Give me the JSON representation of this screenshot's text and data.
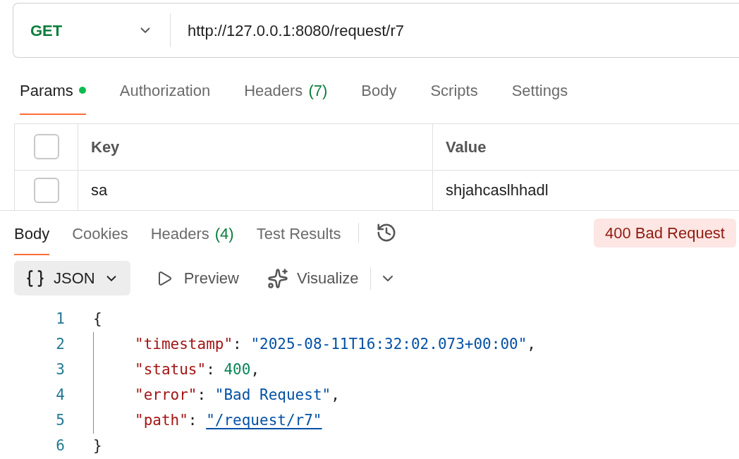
{
  "request_bar": {
    "method": "GET",
    "url": "http://127.0.0.1:8080/request/r7"
  },
  "request_tabs": [
    {
      "label": "Params",
      "dot": true,
      "selected": true
    },
    {
      "label": "Authorization",
      "dot": false,
      "selected": false
    },
    {
      "label": "Headers",
      "count": "(7)",
      "dot": false,
      "selected": false
    },
    {
      "label": "Body",
      "dot": false,
      "selected": false
    },
    {
      "label": "Scripts",
      "dot": false,
      "selected": false
    },
    {
      "label": "Settings",
      "dot": false,
      "selected": false
    }
  ],
  "params_table": {
    "columns": [
      "Key",
      "Value"
    ],
    "header_checked": false,
    "rows": [
      {
        "key": "sa",
        "value": "shjahcaslhhadl",
        "checked": false
      }
    ]
  },
  "response_tabs": [
    {
      "label": "Body",
      "selected": true
    },
    {
      "label": "Cookies",
      "selected": false
    },
    {
      "label": "Headers",
      "count": "(4)",
      "selected": false
    },
    {
      "label": "Test Results",
      "selected": false
    }
  ],
  "status": "400 Bad Request",
  "view_toolbar": {
    "format": "JSON",
    "preview": "Preview",
    "visualize": "Visualize"
  },
  "code_lines": [
    {
      "number": "1",
      "indent": false,
      "tokens": [
        {
          "kind": "punct",
          "text": "{"
        }
      ]
    },
    {
      "number": "2",
      "indent": true,
      "tokens": [
        {
          "kind": "key",
          "text": "\"timestamp\""
        },
        {
          "kind": "punct",
          "text": ": "
        },
        {
          "kind": "string",
          "text": "\"2025-08-11T16:32:02.073+00:00\""
        },
        {
          "kind": "punct",
          "text": ","
        }
      ]
    },
    {
      "number": "3",
      "indent": true,
      "tokens": [
        {
          "kind": "key",
          "text": "\"status\""
        },
        {
          "kind": "punct",
          "text": ": "
        },
        {
          "kind": "number",
          "text": "400"
        },
        {
          "kind": "punct",
          "text": ","
        }
      ]
    },
    {
      "number": "4",
      "indent": true,
      "tokens": [
        {
          "kind": "key",
          "text": "\"error\""
        },
        {
          "kind": "punct",
          "text": ": "
        },
        {
          "kind": "string",
          "text": "\"Bad Request\""
        },
        {
          "kind": "punct",
          "text": ","
        }
      ]
    },
    {
      "number": "5",
      "indent": true,
      "tokens": [
        {
          "kind": "key",
          "text": "\"path\""
        },
        {
          "kind": "punct",
          "text": ": "
        },
        {
          "kind": "link",
          "text": "\"/request/r7\""
        }
      ]
    },
    {
      "number": "6",
      "indent": false,
      "tokens": [
        {
          "kind": "punct",
          "text": "}"
        }
      ]
    }
  ]
}
